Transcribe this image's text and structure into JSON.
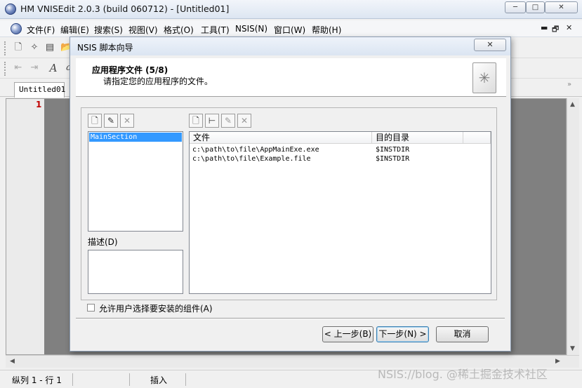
{
  "window": {
    "title": "HM VNISEdit 2.0.3 (build 060712) - [Untitled01]",
    "min": "─",
    "max": "□",
    "close": "✕"
  },
  "menu": {
    "items": [
      "文件(F)",
      "编辑(E)",
      "搜索(S)",
      "视图(V)",
      "格式(O)",
      "工具(T)",
      "NSIS(N)",
      "窗口(W)",
      "帮助(H)"
    ],
    "mdi_min": "▬",
    "mdi_restore": "🗗",
    "mdi_close": "✕"
  },
  "editor": {
    "tab": "Untitled01",
    "tab_scroll": "»",
    "line_numbers": [
      "1"
    ]
  },
  "status": {
    "position": "纵列 1 - 行 1",
    "mode": "插入"
  },
  "watermark": "NSIS://blog. @稀土掘金技术社区",
  "dialog": {
    "title": "NSIS 脚本向导",
    "close": "✕",
    "header": {
      "title": "应用程序文件 (5/8)",
      "subtitle": "请指定您的应用程序的文件。"
    },
    "sections": {
      "items": [
        "MainSection"
      ]
    },
    "description_label": "描述(D)",
    "files": {
      "columns": [
        "文件",
        "目的目录"
      ],
      "rows": [
        {
          "file": "c:\\path\\to\\file\\AppMainExe.exe",
          "dest": "$INSTDIR"
        },
        {
          "file": "c:\\path\\to\\file\\Example.file",
          "dest": "$INSTDIR"
        }
      ]
    },
    "checkbox_label": "允许用户选择要安装的组件(A)",
    "buttons": {
      "back": "< 上一步(B)",
      "next": "下一步(N) >",
      "cancel": "取消"
    }
  }
}
